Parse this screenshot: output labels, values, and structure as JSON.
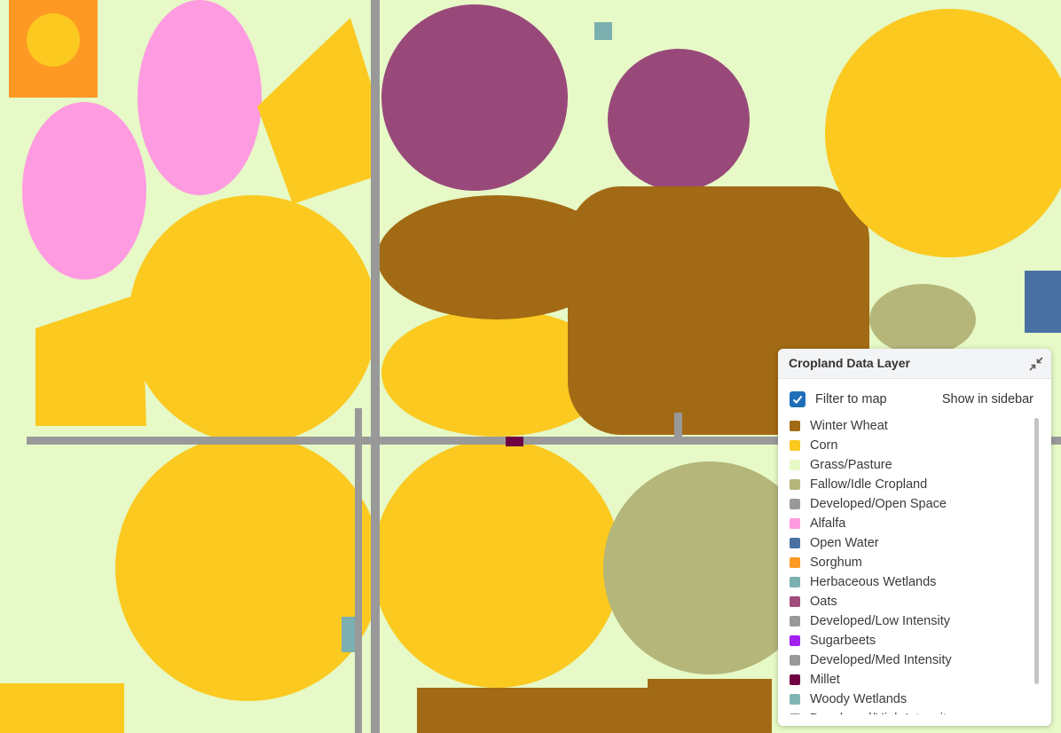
{
  "panel": {
    "title": "Cropland Data Layer",
    "filter_label": "Filter to map",
    "filter_checked": true,
    "sidebar_link": "Show in sidebar",
    "collapse_icon": "collapse-arrows-icon"
  },
  "legend": [
    {
      "label": "Winter Wheat",
      "color": "#a26a15"
    },
    {
      "label": "Corn",
      "color": "#fbc920"
    },
    {
      "label": "Grass/Pasture",
      "color": "#e6f9c7"
    },
    {
      "label": "Fallow/Idle Cropland",
      "color": "#b4b67a"
    },
    {
      "label": "Developed/Open Space",
      "color": "#999999"
    },
    {
      "label": "Alfalfa",
      "color": "#ff9be0"
    },
    {
      "label": "Open Water",
      "color": "#4970a3"
    },
    {
      "label": "Sorghum",
      "color": "#fe9a23"
    },
    {
      "label": "Herbaceous Wetlands",
      "color": "#7cafaf"
    },
    {
      "label": "Oats",
      "color": "#a04b7a"
    },
    {
      "label": "Developed/Low Intensity",
      "color": "#999999"
    },
    {
      "label": "Sugarbeets",
      "color": "#a021f0"
    },
    {
      "label": "Developed/Med Intensity",
      "color": "#999999"
    },
    {
      "label": "Millet",
      "color": "#6f0041"
    },
    {
      "label": "Woody Wetlands",
      "color": "#80b3b3"
    },
    {
      "label": "Developed/High Intensity",
      "color": "#999999"
    }
  ],
  "map_colors": {
    "grass": "#e6f9c7",
    "corn": "#fbc920",
    "wheat": "#a26a15",
    "oats": "#98497a",
    "alfalfa": "#ff9be0",
    "fallow": "#b4b67a",
    "road": "#999999",
    "sorghum": "#fe9a23",
    "water": "#4970a3",
    "wetland": "#7cafaf",
    "millet": "#6f0041"
  }
}
